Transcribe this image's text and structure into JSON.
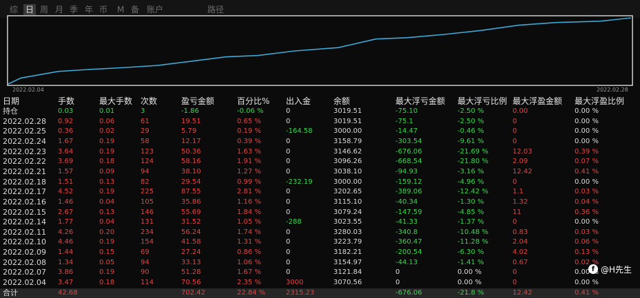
{
  "tabs": [
    {
      "label": "综",
      "active": false
    },
    {
      "label": "日",
      "active": true
    },
    {
      "label": "周",
      "active": false
    },
    {
      "label": "月",
      "active": false
    },
    {
      "label": "季",
      "active": false
    },
    {
      "label": "年",
      "active": false
    },
    {
      "label": "币",
      "active": false
    },
    {
      "label": "M",
      "active": false
    },
    {
      "label": "备",
      "active": false
    },
    {
      "label": "账户",
      "active": false
    },
    {
      "label": "路径",
      "active": false
    }
  ],
  "chart_data": {
    "type": "line",
    "x_labels": [
      "2022.02.04",
      "2022.02.28"
    ],
    "series": [
      {
        "color": "#3fa9d8",
        "values": [
          3070.56,
          3121.84,
          3154.97,
          3182.21,
          3223.79,
          3280.03,
          3023.55,
          3079.24,
          3115.1,
          3202.65,
          3000.0,
          3038.1,
          3096.26,
          3146.62,
          3158.79,
          3000.0,
          3019.51
        ]
      }
    ],
    "curve_color": "#3fa9d8",
    "curve_points": [
      [
        0,
        0.0
      ],
      [
        0.02,
        0.09
      ],
      [
        0.08,
        0.19
      ],
      [
        0.13,
        0.22
      ],
      [
        0.19,
        0.25
      ],
      [
        0.24,
        0.28
      ],
      [
        0.29,
        0.34
      ],
      [
        0.35,
        0.41
      ],
      [
        0.4,
        0.43
      ],
      [
        0.46,
        0.5
      ],
      [
        0.53,
        0.55
      ],
      [
        0.59,
        0.68
      ],
      [
        0.64,
        0.7
      ],
      [
        0.7,
        0.75
      ],
      [
        0.76,
        0.81
      ],
      [
        0.82,
        0.89
      ],
      [
        0.88,
        0.93
      ],
      [
        0.95,
        0.95
      ],
      [
        1.0,
        1.0
      ]
    ]
  },
  "table": {
    "headers": [
      "日期",
      "手数",
      "最大手数",
      "次数",
      "盈亏金额",
      "百分比%",
      "出入金",
      "余额",
      "最大浮亏金额",
      "最大浮亏比例",
      "最大浮盈金额",
      "最大浮盈比例"
    ],
    "rows": [
      {
        "cells": [
          "持仓",
          "0.03",
          "0.01",
          "3",
          "-1.86",
          "-0.06 %",
          "0",
          "3019.51",
          "-75.10",
          "-2.50 %",
          "0.00",
          "0.00 %"
        ],
        "colors": [
          "white",
          "green",
          "green",
          "green",
          "green",
          "green",
          "white",
          "white",
          "green",
          "green",
          "red",
          "white"
        ]
      },
      {
        "cells": [
          "2022.02.28",
          "0.92",
          "0.06",
          "61",
          "19.51",
          "0.65 %",
          "0",
          "3019.51",
          "-75.1",
          "-2.50 %",
          "0",
          "0.00 %"
        ],
        "colors": [
          "white",
          "red",
          "red",
          "red",
          "red",
          "red",
          "white",
          "white",
          "green",
          "green",
          "red",
          "white"
        ]
      },
      {
        "cells": [
          "2022.02.25",
          "0.36",
          "0.02",
          "29",
          "5.79",
          "0.19 %",
          "-164.58",
          "3000.00",
          "-14.47",
          "-0.46 %",
          "0",
          "0.00 %"
        ],
        "colors": [
          "white",
          "red",
          "red",
          "red",
          "red",
          "red",
          "green",
          "white",
          "green",
          "green",
          "red",
          "white"
        ]
      },
      {
        "cells": [
          "2022.02.24",
          "1.67",
          "0.19",
          "58",
          "12.17",
          "0.39 %",
          "0",
          "3158.79",
          "-303.54",
          "-9.61 %",
          "0",
          "0.00 %"
        ],
        "colors": [
          "white",
          "red",
          "red",
          "red",
          "red",
          "red",
          "white",
          "white",
          "green",
          "green",
          "red",
          "white"
        ]
      },
      {
        "cells": [
          "2022.02.23",
          "3.64",
          "0.19",
          "123",
          "50.36",
          "1.63 %",
          "0",
          "3146.62",
          "-676.06",
          "-21.69 %",
          "12.03",
          "0.39 %"
        ],
        "colors": [
          "white",
          "red",
          "red",
          "red",
          "red",
          "red",
          "white",
          "white",
          "green",
          "green",
          "red",
          "red"
        ]
      },
      {
        "cells": [
          "2022.02.22",
          "3.69",
          "0.18",
          "124",
          "58.16",
          "1.91 %",
          "0",
          "3096.26",
          "-668.54",
          "-21.80 %",
          "2.09",
          "0.07 %"
        ],
        "colors": [
          "white",
          "red",
          "red",
          "red",
          "red",
          "red",
          "white",
          "white",
          "green",
          "green",
          "red",
          "red"
        ]
      },
      {
        "cells": [
          "2022.02.21",
          "1.57",
          "0.09",
          "94",
          "38.10",
          "1.27 %",
          "0",
          "3038.10",
          "-94.93",
          "-3.16 %",
          "12.42",
          "0.41 %"
        ],
        "colors": [
          "white",
          "red",
          "red",
          "red",
          "red",
          "red",
          "white",
          "white",
          "green",
          "green",
          "red",
          "red"
        ]
      },
      {
        "cells": [
          "2022.02.18",
          "1.51",
          "0.13",
          "82",
          "29.54",
          "0.99 %",
          "-232.19",
          "3000.00",
          "-159.12",
          "-4.96 %",
          "0",
          "0.00 %"
        ],
        "colors": [
          "white",
          "red",
          "red",
          "red",
          "red",
          "red",
          "green",
          "white",
          "green",
          "green",
          "red",
          "white"
        ]
      },
      {
        "cells": [
          "2022.02.17",
          "4.52",
          "0.19",
          "225",
          "87.55",
          "2.81 %",
          "0",
          "3202.65",
          "-389.06",
          "-12.42 %",
          "1.1",
          "0.03 %"
        ],
        "colors": [
          "white",
          "red",
          "red",
          "red",
          "red",
          "red",
          "white",
          "white",
          "green",
          "green",
          "red",
          "red"
        ]
      },
      {
        "cells": [
          "2022.02.16",
          "1.46",
          "0.04",
          "105",
          "35.86",
          "1.16 %",
          "0",
          "3115.10",
          "-40.34",
          "-1.30 %",
          "1.32",
          "0.04 %"
        ],
        "colors": [
          "white",
          "red",
          "red",
          "red",
          "red",
          "red",
          "white",
          "white",
          "green",
          "green",
          "red",
          "red"
        ]
      },
      {
        "cells": [
          "2022.02.15",
          "2.67",
          "0.13",
          "146",
          "55.69",
          "1.84 %",
          "0",
          "3079.24",
          "-147.59",
          "-4.85 %",
          "11",
          "0.36 %"
        ],
        "colors": [
          "white",
          "red",
          "red",
          "red",
          "red",
          "red",
          "white",
          "white",
          "green",
          "green",
          "red",
          "red"
        ]
      },
      {
        "cells": [
          "2022.02.14",
          "1.77",
          "0.04",
          "131",
          "31.52",
          "1.05 %",
          "-288",
          "3023.55",
          "-41.33",
          "-1.37 %",
          "0",
          "0.00 %"
        ],
        "colors": [
          "white",
          "red",
          "red",
          "red",
          "red",
          "red",
          "green",
          "white",
          "green",
          "green",
          "red",
          "white"
        ]
      },
      {
        "cells": [
          "2022.02.11",
          "4.26",
          "0.20",
          "234",
          "56.24",
          "1.74 %",
          "0",
          "3280.03",
          "-340.8",
          "-10.48 %",
          "0.83",
          "0.03 %"
        ],
        "colors": [
          "white",
          "red",
          "red",
          "red",
          "red",
          "red",
          "white",
          "white",
          "green",
          "green",
          "red",
          "red"
        ]
      },
      {
        "cells": [
          "2022.02.10",
          "4.46",
          "0.19",
          "154",
          "41.58",
          "1.31 %",
          "0",
          "3223.79",
          "-360.47",
          "-11.28 %",
          "2.04",
          "0.06 %"
        ],
        "colors": [
          "white",
          "red",
          "red",
          "red",
          "red",
          "red",
          "white",
          "white",
          "green",
          "green",
          "red",
          "red"
        ]
      },
      {
        "cells": [
          "2022.02.09",
          "1.44",
          "0.15",
          "69",
          "27.24",
          "0.86 %",
          "0",
          "3182.21",
          "-200.54",
          "-6.30 %",
          "4.02",
          "0.13 %"
        ],
        "colors": [
          "white",
          "red",
          "red",
          "red",
          "red",
          "red",
          "white",
          "white",
          "green",
          "green",
          "red",
          "red"
        ]
      },
      {
        "cells": [
          "2022.02.08",
          "1.34",
          "0.05",
          "94",
          "33.13",
          "1.06 %",
          "0",
          "3154.97",
          "-44.13",
          "-1.41 %",
          "0.67",
          "0.02 %"
        ],
        "colors": [
          "white",
          "red",
          "red",
          "red",
          "red",
          "red",
          "white",
          "white",
          "green",
          "green",
          "red",
          "red"
        ]
      },
      {
        "cells": [
          "2022.02.07",
          "3.86",
          "0.19",
          "90",
          "51.28",
          "1.67 %",
          "0",
          "3121.84",
          "0",
          "0.00 %",
          "0",
          "0.00 %"
        ],
        "colors": [
          "white",
          "red",
          "red",
          "red",
          "red",
          "red",
          "white",
          "white",
          "white",
          "white",
          "red",
          "white"
        ]
      },
      {
        "cells": [
          "2022.02.04",
          "3.47",
          "0.18",
          "114",
          "70.56",
          "2.35 %",
          "3000",
          "3070.56",
          "0",
          "0.00 %",
          "0",
          "0.00 %"
        ],
        "colors": [
          "white",
          "red",
          "red",
          "red",
          "red",
          "red",
          "red",
          "white",
          "white",
          "white",
          "red",
          "white"
        ]
      }
    ],
    "total": {
      "cells": [
        "合计",
        "42.68",
        "",
        "",
        "702.42",
        "22.84 %",
        "2315.23",
        "",
        "-676.06",
        "-21.8 %",
        "12.42",
        "0.41 %"
      ],
      "colors": [
        "white",
        "red",
        "red",
        "red",
        "red",
        "red",
        "red",
        "white",
        "green",
        "green",
        "red",
        "red"
      ]
    }
  },
  "watermark": {
    "icon": "f-logo-icon",
    "text": "@H先生"
  }
}
